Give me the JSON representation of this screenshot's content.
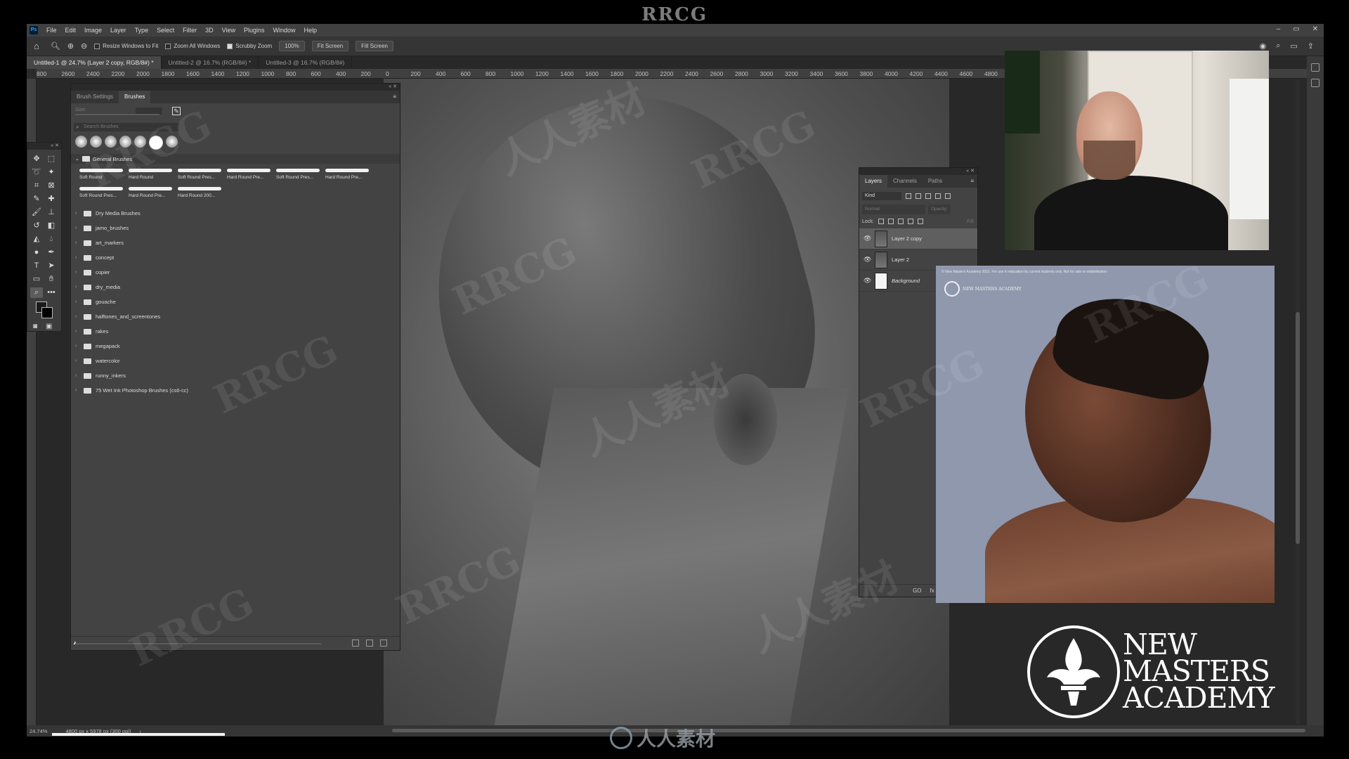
{
  "banner": {
    "text": "RRCG"
  },
  "menubar": {
    "logo": "Ps",
    "items": [
      "File",
      "Edit",
      "Image",
      "Layer",
      "Type",
      "Select",
      "Filter",
      "3D",
      "View",
      "Plugins",
      "Window",
      "Help"
    ],
    "window_controls": [
      "–",
      "▭",
      "✕"
    ]
  },
  "options_bar": {
    "resize_windows": "Resize Windows to Fit",
    "zoom_all": "Zoom All Windows",
    "scrubby_zoom": "Scrubby Zoom",
    "zoom_100": "100%",
    "fit_screen": "Fit Screen",
    "fill_screen": "Fill Screen"
  },
  "doc_tabs": [
    {
      "label": "Untitled-1 @ 24.7% (Layer 2 copy, RGB/8#) *",
      "active": true
    },
    {
      "label": "Untitled-2 @ 16.7% (RGB/8#) *",
      "active": false
    },
    {
      "label": "Untitled-3 @ 16.7% (RGB/8#)",
      "active": false
    }
  ],
  "ruler_labels": [
    "800",
    "2600",
    "2400",
    "2200",
    "2000",
    "1800",
    "1600",
    "1400",
    "1200",
    "1000",
    "800",
    "600",
    "400",
    "200",
    "0",
    "200",
    "400",
    "600",
    "800",
    "1000",
    "1200",
    "1400",
    "1600",
    "1800",
    "2000",
    "2200",
    "2400",
    "2600",
    "2800",
    "3000",
    "3200",
    "3400",
    "3600",
    "3800",
    "4000",
    "4200",
    "4400",
    "4600",
    "4800",
    "",
    "",
    "",
    "",
    "",
    "",
    "",
    "",
    "",
    "72"
  ],
  "brushes_panel": {
    "tabs": [
      "Brush Settings",
      "Brushes"
    ],
    "size_label": "Size:",
    "search_placeholder": "Search Brushes",
    "group_name": "General Brushes",
    "presets": [
      "Soft Round",
      "Hard Round",
      "Soft Round Pres...",
      "Hard Round Pre...",
      "Soft Round Pres...",
      "Hard Round Pre...",
      "Soft Round Pres...",
      "Hard Round Pre...",
      "Hard Round 200..."
    ],
    "folders": [
      "Dry Media Brushes",
      "jamo_brushes",
      "art_markers",
      "concept",
      "copier",
      "dry_media",
      "gouache",
      "halftones_and_screentones",
      "rakes",
      "megapack",
      "watercolor",
      "runny_inkers",
      "75 Wet Ink Photoshop Brushes (cs6-cc)"
    ]
  },
  "layers_panel": {
    "tabs": [
      "Layers",
      "Channels",
      "Paths"
    ],
    "filter_kind": "Kind",
    "blend_mode": "Normal",
    "opacity_label": "Opacity:",
    "fill_label": "Fill:",
    "lock_label": "Lock:",
    "layers": [
      {
        "name": "Layer 2 copy",
        "selected": true,
        "thumb": "gray"
      },
      {
        "name": "Layer 2",
        "selected": false,
        "thumb": "gray"
      },
      {
        "name": "Background",
        "selected": false,
        "thumb": "white"
      }
    ],
    "footer_icons": [
      "GO",
      "fx",
      "◘",
      "◑",
      "▭"
    ]
  },
  "statusbar": {
    "zoom": "24.74%",
    "doc_info": "4800 px x 5978 px (300 ppi)",
    "arrow": "›"
  },
  "reference": {
    "caption": "© New Masters Academy 2021. For use in education by current students only. Not for sale or redistribution.",
    "mark_text": "NEW MASTERS ACADEMY"
  },
  "logo": {
    "lines": [
      "NEW",
      "MASTERS",
      "ACADEMY"
    ]
  },
  "watermark_bottom": "人人素材",
  "watermarks": [
    "RRCG",
    "人人素材"
  ],
  "colors": {
    "accent": "#31a8ff",
    "panel": "#434343",
    "chrome": "#2b2b2b"
  }
}
